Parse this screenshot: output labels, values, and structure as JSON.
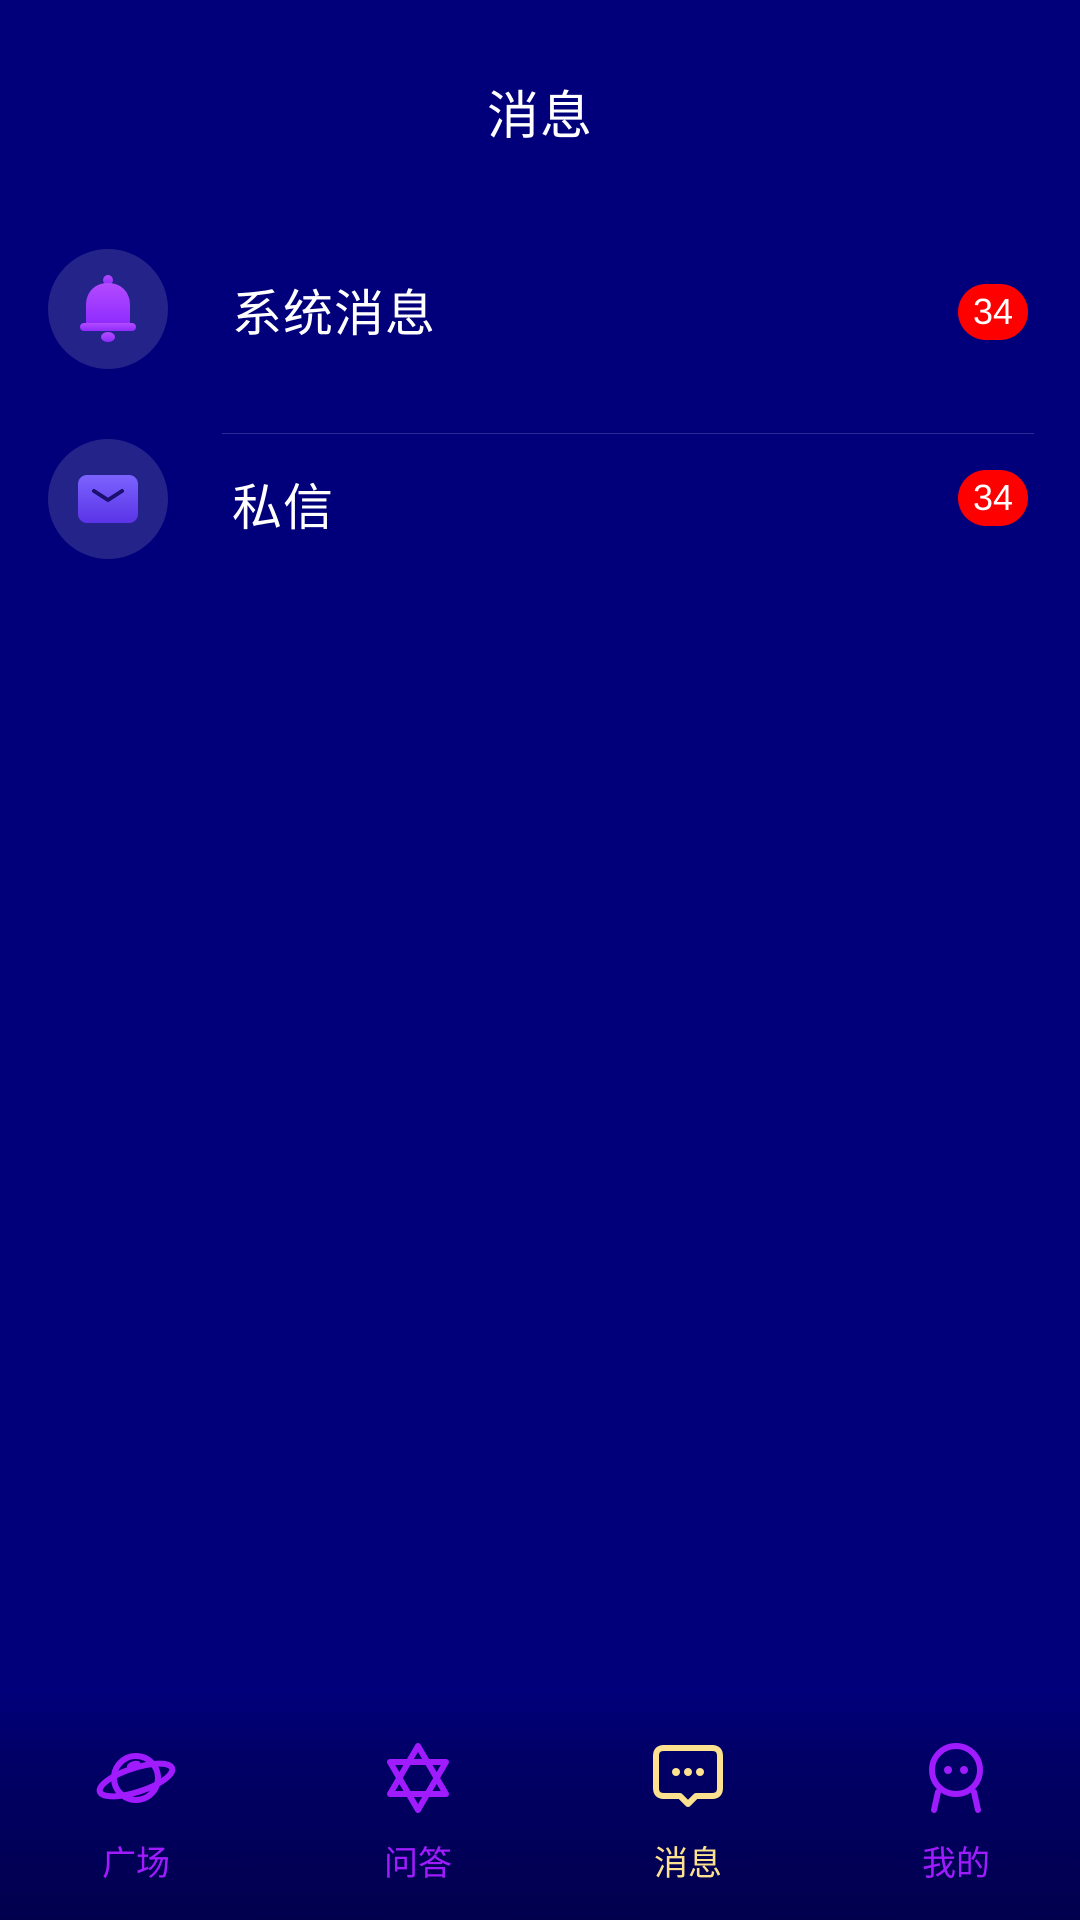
{
  "header": {
    "title": "消息"
  },
  "messages": [
    {
      "label": "系统消息",
      "badge": "34",
      "icon": "bell-icon"
    },
    {
      "label": "私信",
      "badge": "34",
      "icon": "mail-icon"
    }
  ],
  "tabbar": {
    "tabs": [
      {
        "label": "广场",
        "icon": "planet-icon",
        "active": false
      },
      {
        "label": "问答",
        "icon": "star-of-david-icon",
        "active": false
      },
      {
        "label": "消息",
        "icon": "chat-bubble-icon",
        "active": true
      },
      {
        "label": "我的",
        "icon": "person-icon",
        "active": false
      }
    ]
  },
  "colors": {
    "background": "#01007A",
    "badge": "#FF0000",
    "tab_inactive": "#A11BFF",
    "tab_active": "#FCE28F",
    "avatar_bg": "#23238A"
  }
}
